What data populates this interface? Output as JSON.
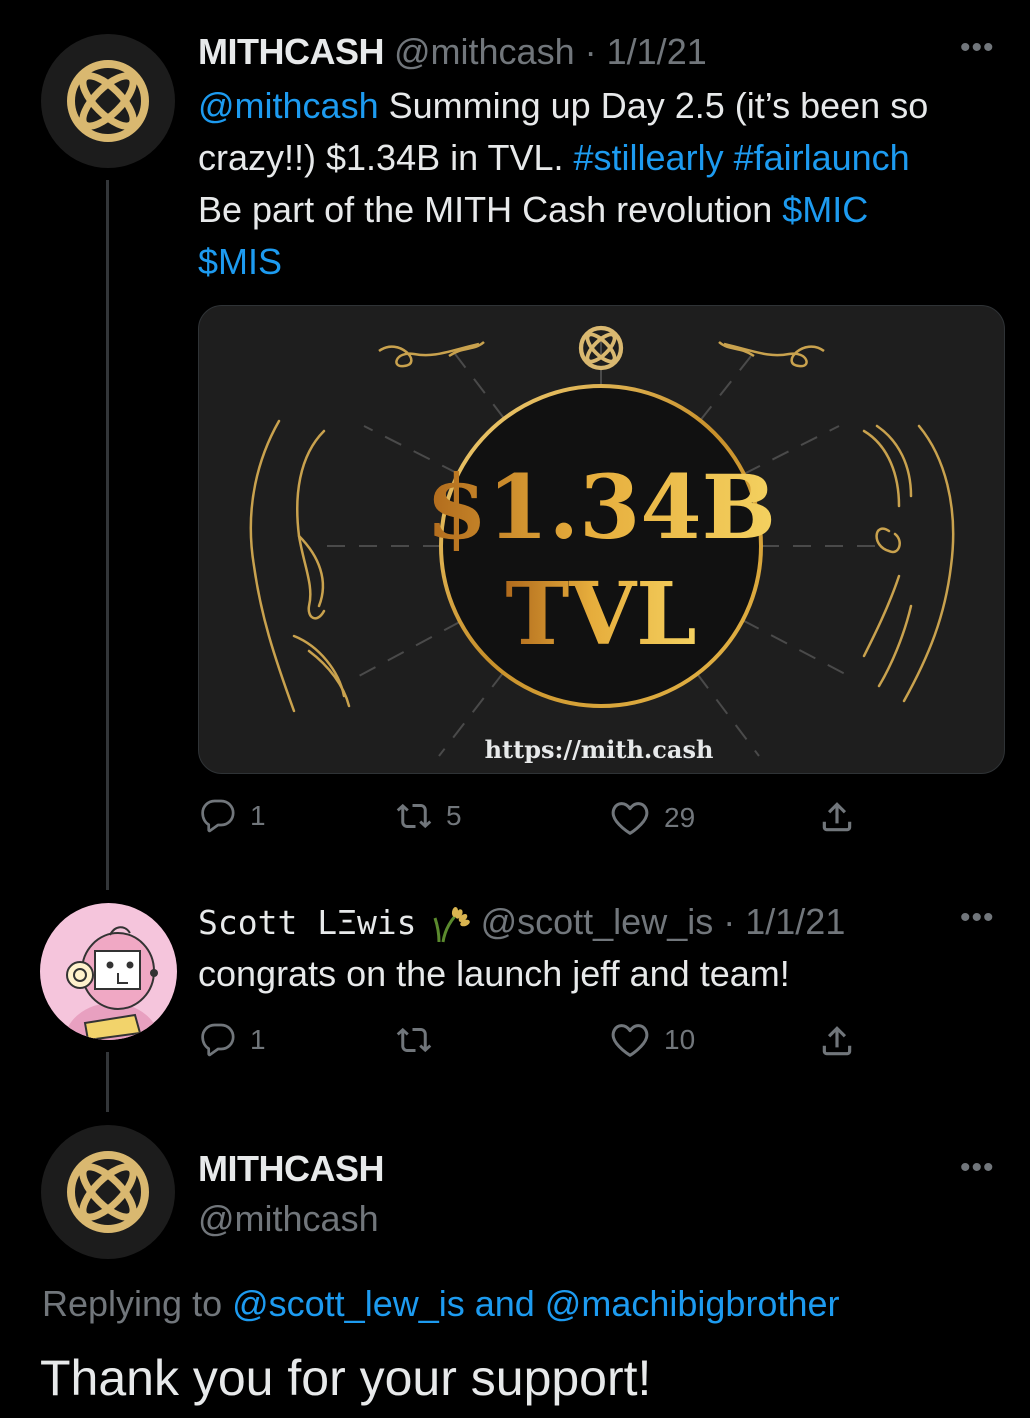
{
  "colors": {
    "background": "#000000",
    "text": "#e7e9ea",
    "muted": "#71767b",
    "link": "#1d9bf0",
    "gold": "#d4a83a"
  },
  "tweet1": {
    "name": "MITHCASH",
    "handle": "@mithcash",
    "separator": "·",
    "date": "1/1/21",
    "more_icon": "more-icon",
    "text": {
      "mention": "@mithcash",
      "part1": " Summing up Day 2.5 (it’s been so crazy!!) $1.34B in TVL. ",
      "hashtag1": "#stillearly",
      "hashtag2": "#fairlaunch",
      "part2": "Be part of the MITH Cash revolution ",
      "cashtag1": "$MIC",
      "cashtag2": "$MIS"
    },
    "image": {
      "line1": "$1.34B",
      "line2": "TVL",
      "url": "https://mith.cash"
    },
    "actions": {
      "replies": "1",
      "retweets": "5",
      "likes": "29"
    }
  },
  "tweet2": {
    "name": "Scott LΞwis",
    "name_emoji": "rice-plant-emoji",
    "handle": "@scott_lew_is",
    "separator": "·",
    "date": "1/1/21",
    "text": "congrats on the launch jeff and team!",
    "actions": {
      "replies": "1",
      "retweets": "",
      "likes": "10"
    }
  },
  "tweet3": {
    "name": "MITHCASH",
    "handle": "@mithcash",
    "replying_prefix": "Replying to ",
    "replying_users": "@scott_lew_is and @machibigbrother",
    "text": "Thank you for your support!"
  }
}
